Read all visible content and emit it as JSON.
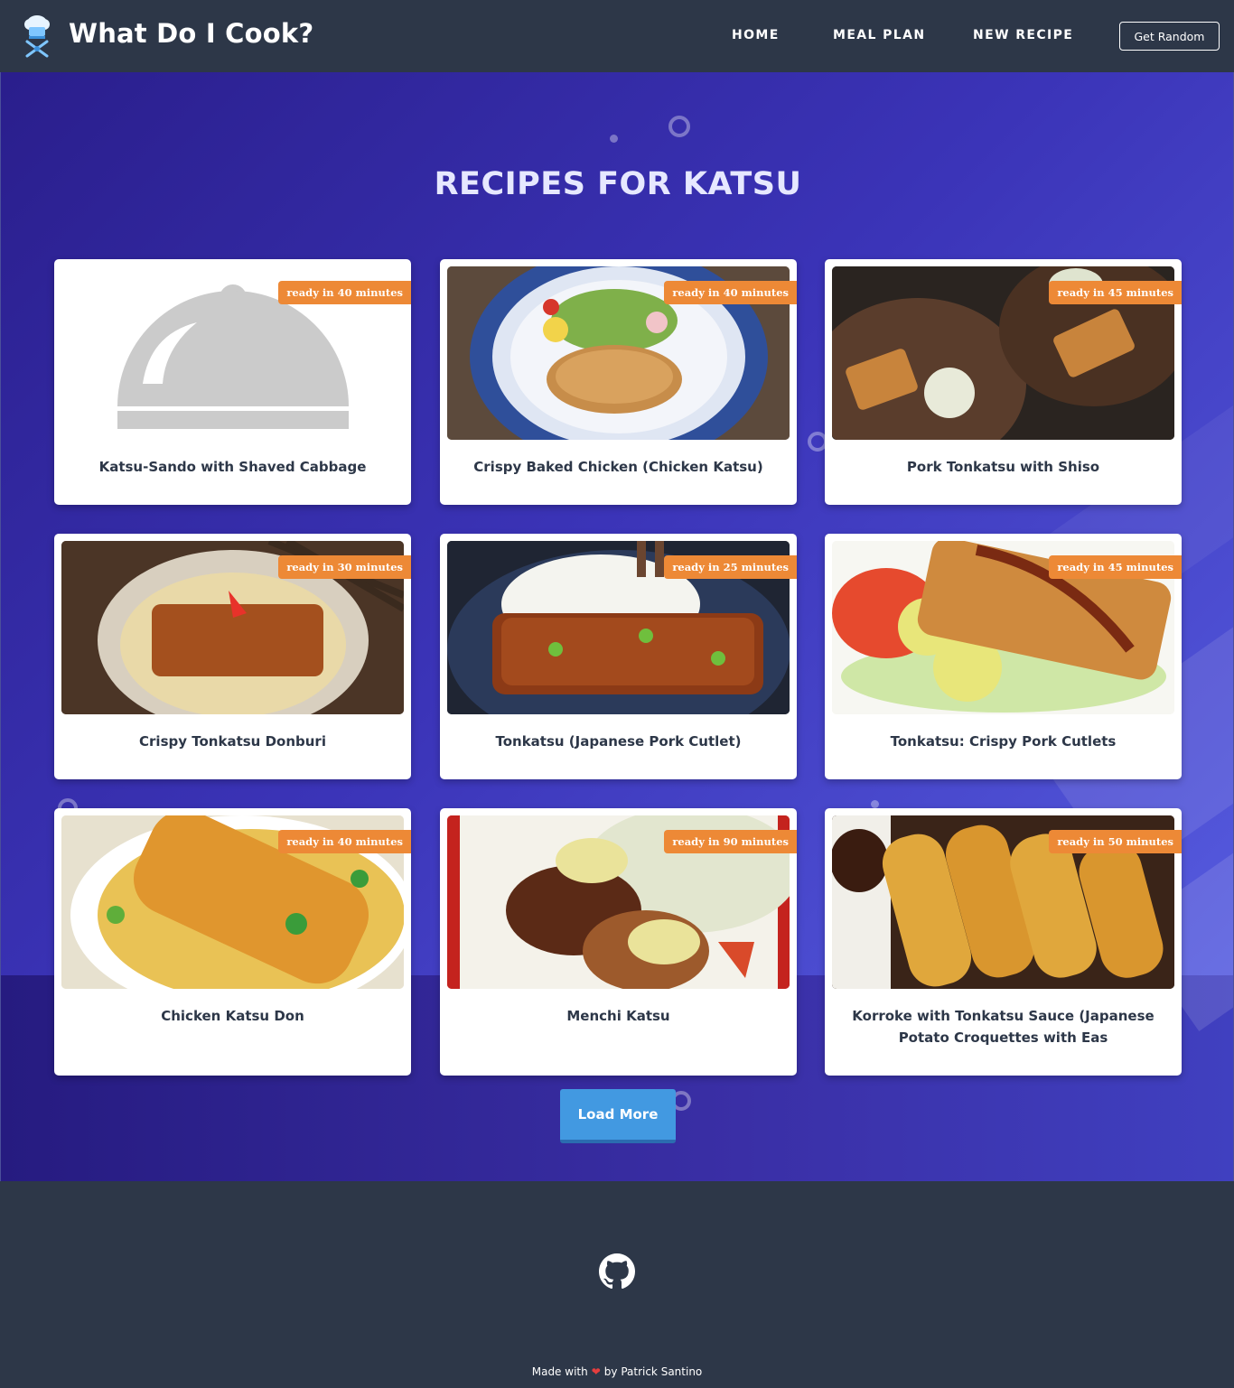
{
  "header": {
    "brand": "What Do I Cook?",
    "logo_icon": "chef-hat-icon",
    "nav": [
      {
        "label": "HOME"
      },
      {
        "label": "MEAL PLAN"
      },
      {
        "label": "NEW RECIPE"
      }
    ],
    "random_button": "Get Random"
  },
  "main": {
    "title": "RECIPES FOR KATSU",
    "recipes": [
      {
        "title": "Katsu-Sando with Shaved Cabbage",
        "ready": "ready in 40 minutes",
        "image": "placeholder-cloche-icon"
      },
      {
        "title": "Crispy Baked Chicken (Chicken Katsu)",
        "ready": "ready in 40 minutes",
        "image": "recipe-photo"
      },
      {
        "title": "Pork Tonkatsu with Shiso",
        "ready": "ready in 45 minutes",
        "image": "recipe-photo"
      },
      {
        "title": "Crispy Tonkatsu Donburi",
        "ready": "ready in 30 minutes",
        "image": "recipe-photo"
      },
      {
        "title": "Tonkatsu (Japanese Pork Cutlet)",
        "ready": "ready in 25 minutes",
        "image": "recipe-photo"
      },
      {
        "title": "Tonkatsu: Crispy Pork Cutlets",
        "ready": "ready in 45 minutes",
        "image": "recipe-photo"
      },
      {
        "title": "Chicken Katsu Don",
        "ready": "ready in 40 minutes",
        "image": "recipe-photo"
      },
      {
        "title": "Menchi Katsu",
        "ready": "ready in 90 minutes",
        "image": "recipe-photo"
      },
      {
        "title": "Korroke with Tonkatsu Sauce (Japanese Potato Croquettes with Eas",
        "ready": "ready in 50 minutes",
        "image": "recipe-photo"
      }
    ],
    "load_more": "Load More"
  },
  "footer": {
    "github_icon": "github-icon",
    "made_with": "Made with",
    "heart_icon": "heart-icon",
    "author": "by Patrick Santino"
  },
  "colors": {
    "header_bg": "#2d3748",
    "badge": "#ed8936",
    "button": "#4299e1",
    "hero_start": "#2a1e8c",
    "hero_end": "#5a62e6"
  }
}
